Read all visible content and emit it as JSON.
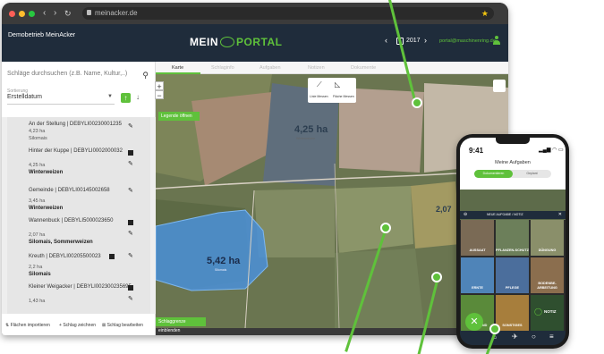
{
  "browser": {
    "url": "meinacker.de",
    "colors": {
      "close": "#ff5f57",
      "min": "#febc2e",
      "max": "#28c840"
    }
  },
  "header": {
    "farm": "Demobetrieb MeinAcker",
    "logo_mein": "MEIN",
    "logo_portal": "PORTAL",
    "year": "2017",
    "email": "portal@maschinenring.de",
    "accent": "#5fc13b",
    "bg": "#1f2c3b"
  },
  "sidebar": {
    "search_placeholder": "Schläge durchsuchen (z.B. Name, Kultur,..)",
    "sort_label": "Sortierung",
    "sort_value": "Erstelldatum",
    "items": [
      {
        "title": "An der Stellung | DEBYLI00230001235",
        "area": "4,23 ha",
        "crop": "Silomais"
      },
      {
        "title": "Hinter der Kuppe | DEBYLI0002000032",
        "area": "4,25 ha",
        "crop": "Winterweizen"
      },
      {
        "title": "Gemeinde | DEBYLI00145002658",
        "area": "3,45 ha",
        "crop": "Winterweizen"
      },
      {
        "title": "Wannenbuck | DEBYLI5000023650",
        "area": "2,07 ha",
        "crop": "Silomais, Sommerweizen"
      },
      {
        "title": "Kreuth | DEBYLI00205500023",
        "area": "2,2 ha",
        "crop": "Silomais"
      },
      {
        "title": "Kleiner Weigacker | DEBYLI002300235695",
        "area": "1,43 ha",
        "crop": ""
      }
    ],
    "footer": {
      "import": "Flächen importieren",
      "draw": "Schlag zeichnen",
      "split": "Schlag bearbeiten"
    }
  },
  "tabs": [
    "Karte",
    "Schlaginfo",
    "Aufgaben",
    "Notizen",
    "Dokumente"
  ],
  "map": {
    "legend_button": "Legende öffnen",
    "measure_line": "Linie Messen",
    "measure_area": "Fläche Messen",
    "field1_area": "4,25 ha",
    "field1_crop": "Winterweizen",
    "field2_area": "5,42 ha",
    "field2_crop": "Silomais",
    "field3_area": "2,07",
    "bottom_button": "Schlaggrenze einblenden"
  },
  "phone": {
    "time": "9:41",
    "title": "Meine Aufgaben",
    "seg_active": "Dokumentieren",
    "seg_inactive": "Geplant",
    "bar_title": "NEUE AUFGABE / NOTIZ",
    "tiles": [
      "AUSSAAT",
      "PFLANZEN-SCHUTZ",
      "DÜNGUNG",
      "ERNTE",
      "PFLEGE",
      "BODENBE-ARBEITUNG",
      "GRÜNLAND",
      "SONSTIGES",
      "NOTIZ"
    ]
  }
}
